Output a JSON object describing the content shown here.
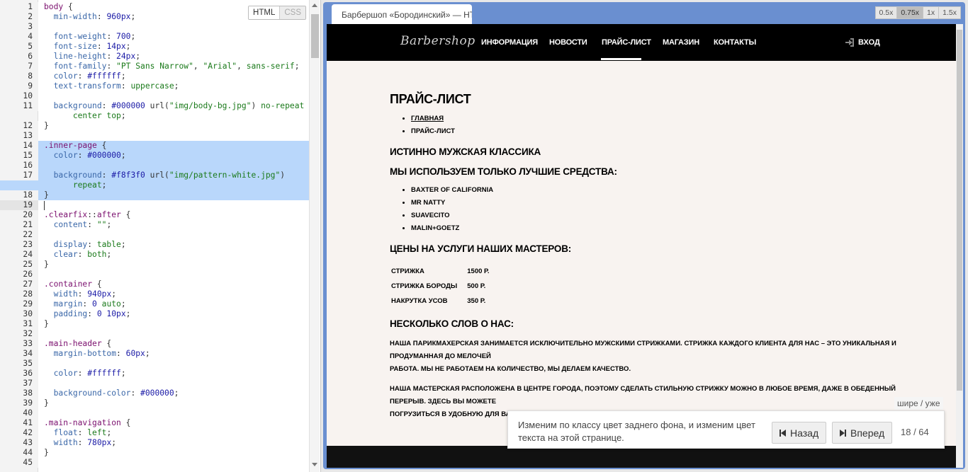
{
  "editor": {
    "mode_html": "HTML",
    "mode_css": "CSS",
    "lines": [
      {
        "n": "1",
        "tokens": [
          [
            "sel",
            "body"
          ],
          [
            "pun",
            " {"
          ]
        ]
      },
      {
        "n": "2",
        "tokens": [
          [
            "pun",
            "  "
          ],
          [
            "prop",
            "min-width"
          ],
          [
            "pun",
            ": "
          ],
          [
            "num",
            "960px"
          ],
          [
            "pun",
            ";"
          ]
        ]
      },
      {
        "n": "3",
        "tokens": []
      },
      {
        "n": "4",
        "tokens": [
          [
            "pun",
            "  "
          ],
          [
            "prop",
            "font-weight"
          ],
          [
            "pun",
            ": "
          ],
          [
            "num",
            "700"
          ],
          [
            "pun",
            ";"
          ]
        ]
      },
      {
        "n": "5",
        "tokens": [
          [
            "pun",
            "  "
          ],
          [
            "prop",
            "font-size"
          ],
          [
            "pun",
            ": "
          ],
          [
            "num",
            "14px"
          ],
          [
            "pun",
            ";"
          ]
        ]
      },
      {
        "n": "6",
        "tokens": [
          [
            "pun",
            "  "
          ],
          [
            "prop",
            "line-height"
          ],
          [
            "pun",
            ": "
          ],
          [
            "num",
            "24px"
          ],
          [
            "pun",
            ";"
          ]
        ]
      },
      {
        "n": "7",
        "tokens": [
          [
            "pun",
            "  "
          ],
          [
            "prop",
            "font-family"
          ],
          [
            "pun",
            ": "
          ],
          [
            "str",
            "\"PT Sans Narrow\""
          ],
          [
            "pun",
            ", "
          ],
          [
            "str",
            "\"Arial\""
          ],
          [
            "pun",
            ", "
          ],
          [
            "val",
            "sans-serif"
          ],
          [
            "pun",
            ";"
          ]
        ]
      },
      {
        "n": "8",
        "tokens": [
          [
            "pun",
            "  "
          ],
          [
            "prop",
            "color"
          ],
          [
            "pun",
            ": "
          ],
          [
            "num",
            "#ffffff"
          ],
          [
            "pun",
            ";"
          ]
        ]
      },
      {
        "n": "9",
        "tokens": [
          [
            "pun",
            "  "
          ],
          [
            "prop",
            "text-transform"
          ],
          [
            "pun",
            ": "
          ],
          [
            "val",
            "uppercase"
          ],
          [
            "pun",
            ";"
          ]
        ]
      },
      {
        "n": "10",
        "tokens": []
      },
      {
        "n": "11",
        "tokens": [
          [
            "pun",
            "  "
          ],
          [
            "prop",
            "background"
          ],
          [
            "pun",
            ": "
          ],
          [
            "num",
            "#000000"
          ],
          [
            "pun",
            " url("
          ],
          [
            "str",
            "\"img/body-bg.jpg\""
          ],
          [
            "pun",
            ") "
          ],
          [
            "val",
            "no-repeat"
          ]
        ]
      },
      {
        "n": "",
        "tokens": [
          [
            "pun",
            "      "
          ],
          [
            "val",
            "center top"
          ],
          [
            "pun",
            ";"
          ]
        ]
      },
      {
        "n": "12",
        "tokens": [
          [
            "pun",
            "}"
          ]
        ]
      },
      {
        "n": "13",
        "tokens": []
      },
      {
        "n": "14",
        "hl": true,
        "tokens": [
          [
            "sel",
            ".inner-page"
          ],
          [
            "pun",
            " {"
          ]
        ]
      },
      {
        "n": "15",
        "hl": true,
        "tokens": [
          [
            "pun",
            "  "
          ],
          [
            "prop",
            "color"
          ],
          [
            "pun",
            ": "
          ],
          [
            "num",
            "#000000"
          ],
          [
            "pun",
            ";"
          ]
        ]
      },
      {
        "n": "16",
        "hl": true,
        "tokens": []
      },
      {
        "n": "17",
        "hl": true,
        "tokens": [
          [
            "pun",
            "  "
          ],
          [
            "prop",
            "background"
          ],
          [
            "pun",
            ": "
          ],
          [
            "num",
            "#f8f3f0"
          ],
          [
            "pun",
            " url("
          ],
          [
            "str",
            "\"img/pattern-white.jpg\""
          ],
          [
            "pun",
            ")"
          ]
        ]
      },
      {
        "n": "",
        "hl": true,
        "tokens": [
          [
            "pun",
            "      "
          ],
          [
            "val",
            "repeat"
          ],
          [
            "pun",
            ";"
          ]
        ]
      },
      {
        "n": "18",
        "hl": true,
        "tokens": [
          [
            "pun",
            "}"
          ]
        ]
      },
      {
        "n": "19",
        "cur": true,
        "tokens": []
      },
      {
        "n": "20",
        "tokens": [
          [
            "sel",
            ".clearfix"
          ],
          [
            "pun",
            "::"
          ],
          [
            "sel",
            "after"
          ],
          [
            "pun",
            " {"
          ]
        ]
      },
      {
        "n": "21",
        "tokens": [
          [
            "pun",
            "  "
          ],
          [
            "prop",
            "content"
          ],
          [
            "pun",
            ": "
          ],
          [
            "str",
            "\"\""
          ],
          [
            "pun",
            ";"
          ]
        ]
      },
      {
        "n": "22",
        "tokens": []
      },
      {
        "n": "23",
        "tokens": [
          [
            "pun",
            "  "
          ],
          [
            "prop",
            "display"
          ],
          [
            "pun",
            ": "
          ],
          [
            "val",
            "table"
          ],
          [
            "pun",
            ";"
          ]
        ]
      },
      {
        "n": "24",
        "tokens": [
          [
            "pun",
            "  "
          ],
          [
            "prop",
            "clear"
          ],
          [
            "pun",
            ": "
          ],
          [
            "val",
            "both"
          ],
          [
            "pun",
            ";"
          ]
        ]
      },
      {
        "n": "25",
        "tokens": [
          [
            "pun",
            "}"
          ]
        ]
      },
      {
        "n": "26",
        "tokens": []
      },
      {
        "n": "27",
        "tokens": [
          [
            "sel",
            ".container"
          ],
          [
            "pun",
            " {"
          ]
        ]
      },
      {
        "n": "28",
        "tokens": [
          [
            "pun",
            "  "
          ],
          [
            "prop",
            "width"
          ],
          [
            "pun",
            ": "
          ],
          [
            "num",
            "940px"
          ],
          [
            "pun",
            ";"
          ]
        ]
      },
      {
        "n": "29",
        "tokens": [
          [
            "pun",
            "  "
          ],
          [
            "prop",
            "margin"
          ],
          [
            "pun",
            ": "
          ],
          [
            "num",
            "0"
          ],
          [
            "pun",
            " "
          ],
          [
            "val",
            "auto"
          ],
          [
            "pun",
            ";"
          ]
        ]
      },
      {
        "n": "30",
        "tokens": [
          [
            "pun",
            "  "
          ],
          [
            "prop",
            "padding"
          ],
          [
            "pun",
            ": "
          ],
          [
            "num",
            "0 10px"
          ],
          [
            "pun",
            ";"
          ]
        ]
      },
      {
        "n": "31",
        "tokens": [
          [
            "pun",
            "}"
          ]
        ]
      },
      {
        "n": "32",
        "tokens": []
      },
      {
        "n": "33",
        "tokens": [
          [
            "sel",
            ".main-header"
          ],
          [
            "pun",
            " {"
          ]
        ]
      },
      {
        "n": "34",
        "tokens": [
          [
            "pun",
            "  "
          ],
          [
            "prop",
            "margin-bottom"
          ],
          [
            "pun",
            ": "
          ],
          [
            "num",
            "60px"
          ],
          [
            "pun",
            ";"
          ]
        ]
      },
      {
        "n": "35",
        "tokens": []
      },
      {
        "n": "36",
        "tokens": [
          [
            "pun",
            "  "
          ],
          [
            "prop",
            "color"
          ],
          [
            "pun",
            ": "
          ],
          [
            "num",
            "#ffffff"
          ],
          [
            "pun",
            ";"
          ]
        ]
      },
      {
        "n": "37",
        "tokens": []
      },
      {
        "n": "38",
        "tokens": [
          [
            "pun",
            "  "
          ],
          [
            "prop",
            "background-color"
          ],
          [
            "pun",
            ": "
          ],
          [
            "num",
            "#000000"
          ],
          [
            "pun",
            ";"
          ]
        ]
      },
      {
        "n": "39",
        "tokens": [
          [
            "pun",
            "}"
          ]
        ]
      },
      {
        "n": "40",
        "tokens": []
      },
      {
        "n": "41",
        "tokens": [
          [
            "sel",
            ".main-navigation"
          ],
          [
            "pun",
            " {"
          ]
        ]
      },
      {
        "n": "42",
        "tokens": [
          [
            "pun",
            "  "
          ],
          [
            "prop",
            "float"
          ],
          [
            "pun",
            ": "
          ],
          [
            "val",
            "left"
          ],
          [
            "pun",
            ";"
          ]
        ]
      },
      {
        "n": "43",
        "tokens": [
          [
            "pun",
            "  "
          ],
          [
            "prop",
            "width"
          ],
          [
            "pun",
            ": "
          ],
          [
            "num",
            "780px"
          ],
          [
            "pun",
            ";"
          ]
        ]
      },
      {
        "n": "44",
        "tokens": [
          [
            "pun",
            "}"
          ]
        ]
      },
      {
        "n": "45",
        "tokens": []
      }
    ]
  },
  "preview": {
    "tab_title": "Барбершоп «Бородинский» — HTML Academy",
    "zoom_options": [
      "0.5x",
      "0.75x",
      "1x",
      "1.5x"
    ],
    "zoom_active": "0.75x",
    "site": {
      "logo": "Barbershop",
      "nav": [
        "ИНФОРМАЦИЯ",
        "НОВОСТИ",
        "ПРАЙС-ЛИСТ",
        "МАГАЗИН",
        "КОНТАКТЫ"
      ],
      "login": "ВХОД",
      "page_title": "ПРАЙС-ЛИСТ",
      "breadcrumbs": [
        "ГЛАВНАЯ",
        "ПРАЙС-ЛИСТ"
      ],
      "subtitle": "ИСТИННО МУЖСКАЯ КЛАССИКА",
      "products_title": "МЫ ИСПОЛЬЗУЕМ ТОЛЬКО ЛУЧШИЕ СРЕДСТВА:",
      "products": [
        "BAXTER OF CALIFORNIA",
        "MR NATTY",
        "SUAVECITO",
        "MALIN+GOETZ"
      ],
      "prices_title": "ЦЕНЫ НА УСЛУГИ НАШИХ МАСТЕРОВ:",
      "prices": [
        {
          "service": "СТРИЖКА",
          "price": "1500 Р."
        },
        {
          "service": "СТРИЖКА БОРОДЫ",
          "price": "500 Р."
        },
        {
          "service": "НАКРУТКА УСОВ",
          "price": "350 Р."
        }
      ],
      "about_title": "НЕСКОЛЬКО СЛОВ О НАС:",
      "about_p1_l1": "НАША ПАРИКМАХЕРСКАЯ ЗАНИМАЕТСЯ ИСКЛЮЧИТЕЛЬНО МУЖСКИМИ СТРИЖКАМИ. СТРИЖКА КАЖДОГО КЛИЕНТА ДЛЯ НАС – ЭТО УНИКАЛЬНАЯ И ПРОДУМАННАЯ ДО МЕЛОЧЕЙ",
      "about_p1_l2": "РАБОТА. МЫ НЕ РАБОТАЕМ НА КОЛИЧЕСТВО, МЫ ДЕЛАЕМ КАЧЕСТВО.",
      "about_p2_l1": "НАША МАСТЕРСКАЯ РАСПОЛОЖЕНА В ЦЕНТРЕ ГОРОДА, ПОЭТОМУ СДЕЛАТЬ СТИЛЬНУЮ СТРИЖКУ МОЖНО В ЛЮБОЕ ВРЕМЯ, ДАЖЕ В ОБЕДЕННЫЙ ПЕРЕРЫВ. ЗДЕСЬ ВЫ МОЖЕТЕ",
      "about_p2_l2": "ПОГРУЗИТЬСЯ В УДОБНУЮ ДЛЯ ВАС АТМОСФЕРУ, ЧУВСТВОВАТЬ СЕБЯ КОМФОРТНО И СВОБОДНО!"
    }
  },
  "lesson": {
    "wider_narrower": "шире / уже",
    "instruction": "Изменим по классу цвет заднего фона, и изменим цвет текста на этой странице.",
    "back": "Назад",
    "forward": "Вперед",
    "counter": "18 / 64"
  },
  "colors": {
    "selection": "#b9d7fb",
    "frame_blue": "#6a8fd0",
    "page_bg": "#f8f3f0"
  }
}
